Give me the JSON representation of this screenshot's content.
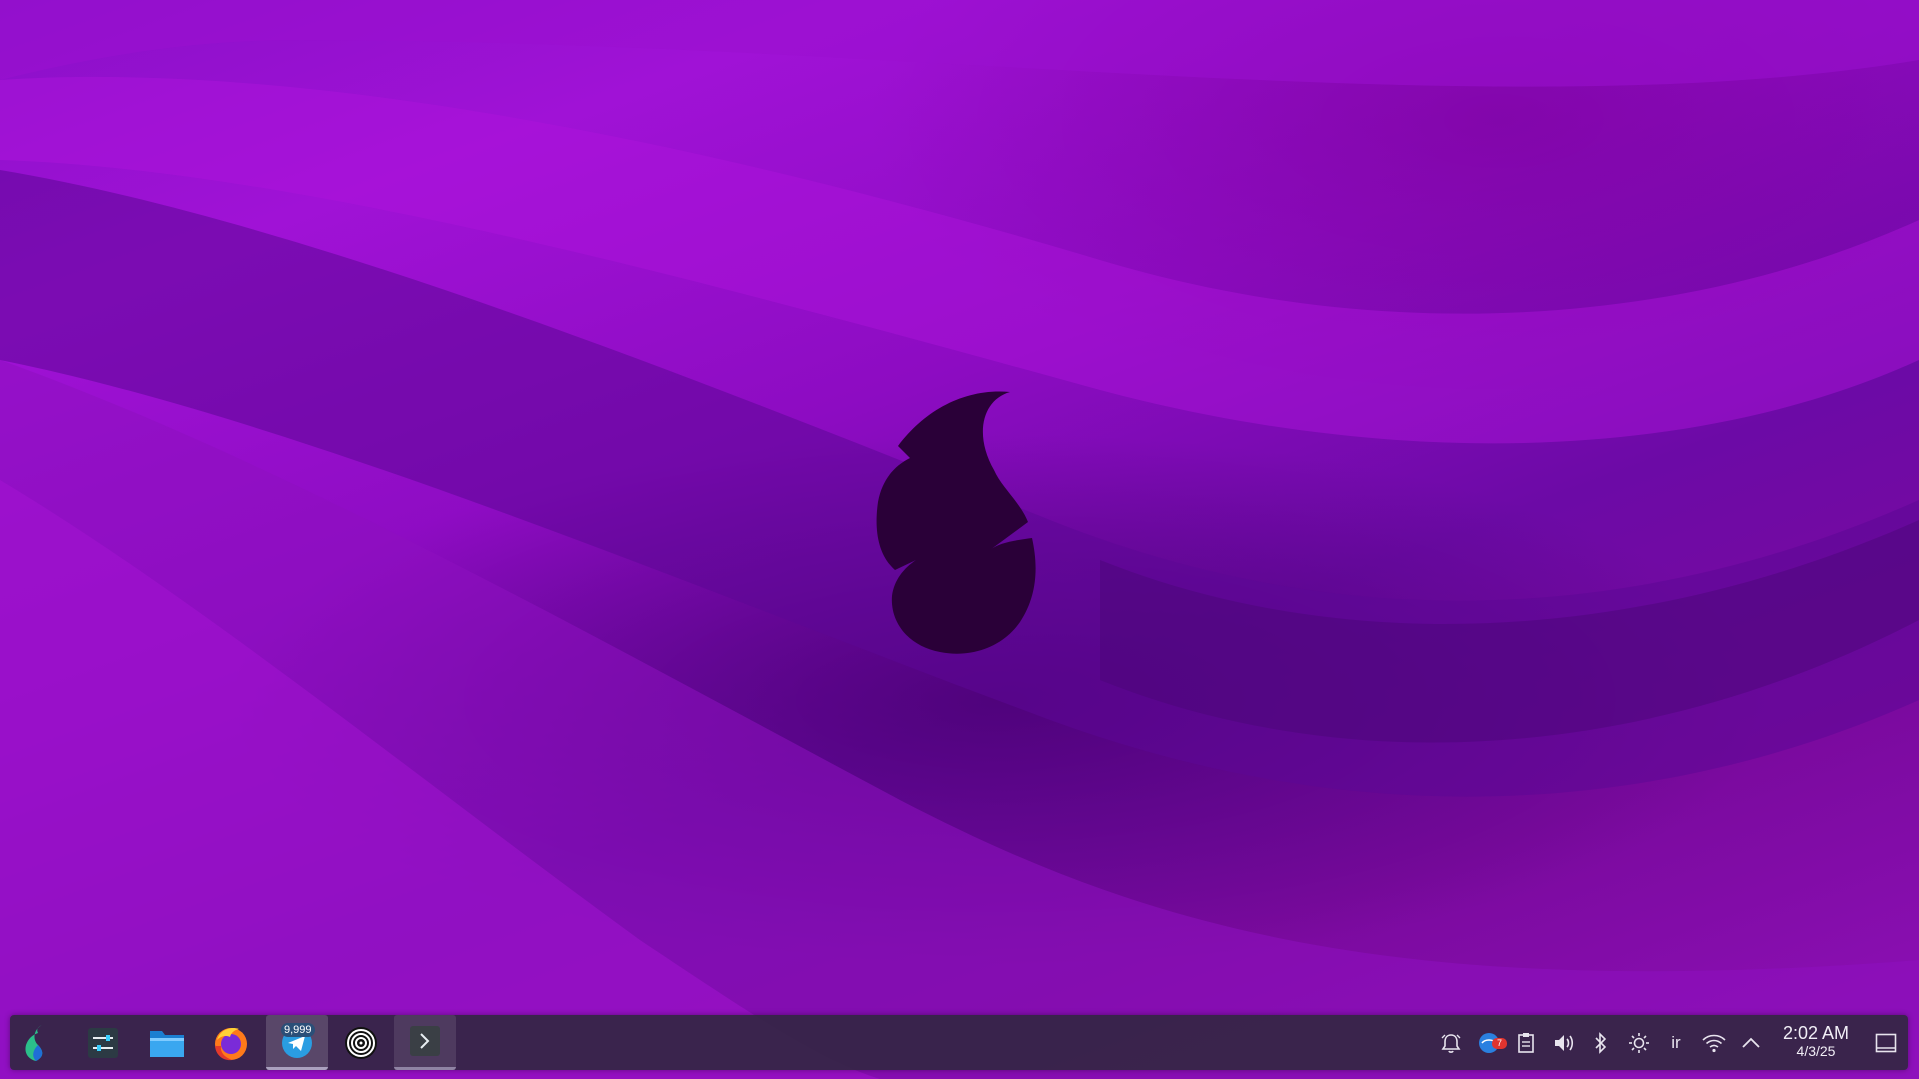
{
  "desktop": {
    "wallpaper": "purple-waves",
    "logo_icon": "wallpaper-flame-logo",
    "accent_colors": [
      "#8a10c8",
      "#6c0aa6",
      "#2c0040"
    ]
  },
  "taskbar": {
    "launcher_icon": "app-launcher-icon",
    "pinned": [
      {
        "icon": "system-settings-icon"
      },
      {
        "icon": "file-manager-icon"
      },
      {
        "icon": "firefox-icon"
      },
      {
        "icon": "telegram-icon",
        "badge": "9,999"
      },
      {
        "icon": "target-app-icon"
      },
      {
        "icon": "terminal-icon"
      }
    ],
    "tray": {
      "notifications_badge": "7",
      "keyboard_layout": "ir",
      "icons": [
        "alarm-bell-icon",
        "notifier-icon",
        "clipboard-icon",
        "volume-icon",
        "bluetooth-icon",
        "brightness-icon",
        "keyboard-layout-icon",
        "wifi-icon",
        "expand-tray-icon",
        "show-desktop-icon"
      ]
    },
    "clock": {
      "time": "2:02 AM",
      "date": "4/3/25"
    }
  }
}
